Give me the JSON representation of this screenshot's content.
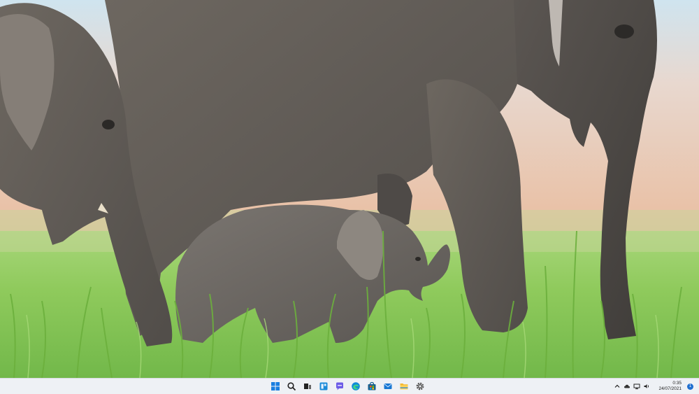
{
  "wallpaper": {
    "subject": "elephant family with calf in tall grass"
  },
  "taskbar": {
    "apps": [
      {
        "name": "start",
        "icon": "windows-logo-icon"
      },
      {
        "name": "search",
        "icon": "search-icon"
      },
      {
        "name": "task-view",
        "icon": "task-view-icon"
      },
      {
        "name": "widgets",
        "icon": "widgets-icon"
      },
      {
        "name": "chat",
        "icon": "chat-icon"
      },
      {
        "name": "edge",
        "icon": "edge-icon"
      },
      {
        "name": "store",
        "icon": "store-icon"
      },
      {
        "name": "mail",
        "icon": "mail-icon"
      },
      {
        "name": "file-explorer",
        "icon": "folder-icon"
      },
      {
        "name": "settings",
        "icon": "gear-icon"
      }
    ],
    "tray": {
      "icons": [
        "chevron-up-icon",
        "cloud-icon",
        "network-icon",
        "volume-icon"
      ],
      "time": "0:35",
      "date": "24/07/2021",
      "notification_count": "1"
    },
    "colors": {
      "background": "#eef1f5",
      "accent": "#1f6fd0"
    }
  }
}
